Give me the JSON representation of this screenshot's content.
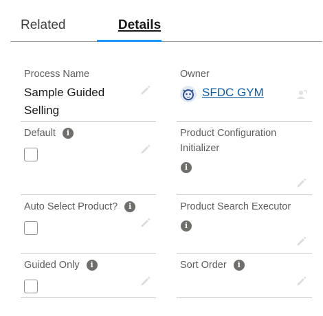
{
  "tabs": {
    "related": "Related",
    "details": "Details"
  },
  "fields": {
    "process_name": {
      "label": "Process Name",
      "value": "Sample Guided Selling"
    },
    "owner": {
      "label": "Owner",
      "value": "SFDC GYM"
    },
    "default": {
      "label": "Default",
      "checked": false
    },
    "product_configuration_initializer": {
      "label": "Product Configuration Initializer"
    },
    "auto_select_product": {
      "label": "Auto Select Product?",
      "checked": false
    },
    "product_search_executor": {
      "label": "Product Search Executor"
    },
    "guided_only": {
      "label": "Guided Only",
      "checked": false
    },
    "sort_order": {
      "label": "Sort Order"
    }
  },
  "icons": {
    "info": "i",
    "edit": "pencil-icon",
    "change_owner": "change-owner-icon",
    "avatar": "astro-avatar"
  },
  "colors": {
    "tab_active_indicator": "#1b96ff",
    "link": "#0b5cab",
    "info_icon_bg": "#706e6b"
  }
}
